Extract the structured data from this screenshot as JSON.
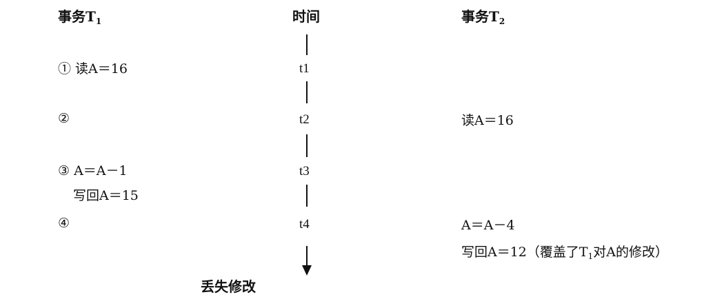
{
  "headers": {
    "t1_prefix": "事务T",
    "t1_sub": "1",
    "time": "时间",
    "t2_prefix": "事务T",
    "t2_sub": "2"
  },
  "time_labels": [
    "t1",
    "t2",
    "t3",
    "t4"
  ],
  "t1_steps": {
    "s1": "① 读A＝16",
    "s2": "②",
    "s3": "③ A＝A－1",
    "s3b": "写回A＝15",
    "s4": "④"
  },
  "t2_steps": {
    "r2": "读A＝16",
    "r4": "A＝A－4",
    "r4b_prefix": "写回A＝12（覆盖了T",
    "r4b_sub": "1",
    "r4b_suffix": "对A的修改）"
  },
  "caption": "丢失修改"
}
